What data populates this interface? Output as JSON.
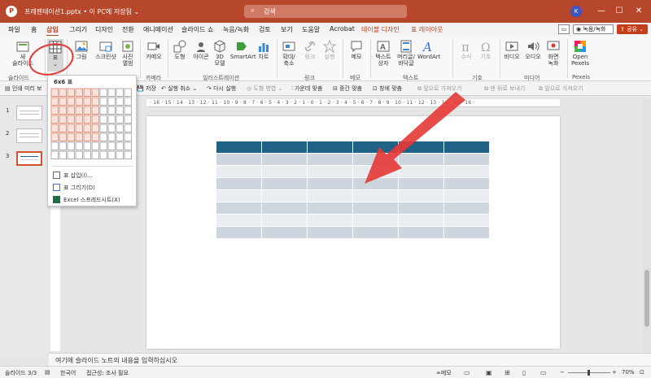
{
  "titlebar": {
    "doc_title": "프레젠테이션1.pptx • 이 PC에 저장됨 ⌄",
    "search_placeholder": "검색",
    "avatar_initial": "K",
    "minimize": "—",
    "maximize": "☐",
    "close": "✕",
    "app_logo": "P"
  },
  "menu_tabs": [
    "파일",
    "홈",
    "삽입",
    "그리기",
    "디자인",
    "전환",
    "애니메이션",
    "슬라이드 쇼",
    "녹음/녹화",
    "검토",
    "보기",
    "도움말",
    "Acrobat"
  ],
  "context_tabs": [
    "테이블 디자인",
    "표 레이아웃"
  ],
  "active_tab": "삽입",
  "top_right": {
    "comment": "▭",
    "record": "◉ 녹음/녹화",
    "share": "⇪ 공유 ⌄"
  },
  "ribbon": {
    "new_slide": "새\n슬라이드",
    "table": "표",
    "image": "그림",
    "screenshot": "스크린샷",
    "album": "사진\n앨범",
    "camera": "카메오",
    "shapes": "도형",
    "icons": "아이콘",
    "model3d": "3D\n모델",
    "smartart": "SmartArt",
    "chart": "차트",
    "zoom": "확대/\n축소",
    "link": "링크",
    "action": "실행",
    "comment": "메모",
    "textbox": "텍스트\n상자",
    "header_footer": "머리글/\n바닥글",
    "wordart": "WordArt",
    "equation": "수식",
    "symbol": "기호",
    "video": "비디오",
    "audio": "오디오",
    "screen_record": "화면\n녹화",
    "pexels": "Open\nPexels"
  },
  "ribbon_groups": {
    "slides": "슬라이드",
    "camera": "카메라",
    "illustrations": "일러스트레이션",
    "link": "링크",
    "comment": "메모",
    "text": "텍스트",
    "symbols": "기호",
    "media": "미디어",
    "pexels": "Pexels"
  },
  "qat": {
    "print": "인쇄 미리 보",
    "save": "저장",
    "undo": "실행 취소 ⌄",
    "redo": "다시 실행",
    "shape_merge": "도형 병합 ⌄",
    "center_h": "가운데 맞춤",
    "center_v": "중간 맞춤",
    "fit_window": "창에 맞춤",
    "bring_forward": "앞으로 가져오기",
    "send_backward": "맨 뒤로 보내기",
    "bring_front": "앞으로 가져오기"
  },
  "ruler_ticks": "· 16 · 15 · 14 · 13 · 12 · 11 · 10 · 9 · 8 · 7 · 6 · 5 · 4 · 3 · 2 · 1 · 0 · 1 · 2 · 3 · 4 · 5 · 6 · 7 · 8 · 9 · 10 · 11 · 12 · 13 · 14 · 15 · 16 ·",
  "slide_numbers": [
    "1",
    "2",
    "3"
  ],
  "table_dropdown": {
    "title": "6x6 표",
    "insert_table": "표 삽입(I)...",
    "draw_table": "표 그리기(D)",
    "excel": "Excel 스프레드시트(X)"
  },
  "notes_placeholder": "여기에 슬라이드 노트의 내용을 입력하십시오",
  "status": {
    "slide_info": "슬라이드 3/3",
    "language": "한국어",
    "accessibility": "접근성: 조사 필요",
    "notes": "≐메모",
    "zoom": "70%"
  },
  "colors": {
    "accent": "#b7472a",
    "table_header": "#1f6285",
    "annotation": "#e53935"
  }
}
